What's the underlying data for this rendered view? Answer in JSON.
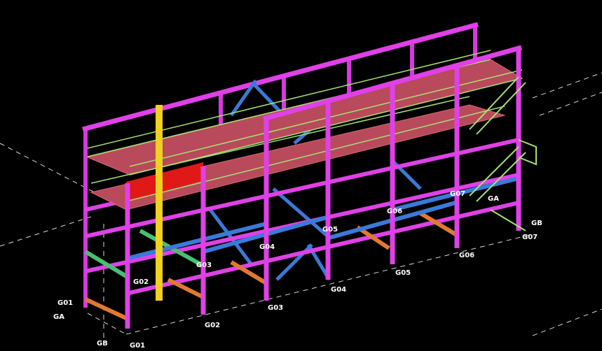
{
  "colors": {
    "background": "#000000",
    "column": "#e040e8",
    "deck": "#b84a5c",
    "deck_red": "#e01818",
    "railing": "#a8e070",
    "brace_blue": "#3a7ad8",
    "brace_orange": "#e07a30",
    "beam_green": "#48c070",
    "yellow": "#f0d020",
    "label": "#ffffff",
    "gridline": "#ffffff"
  },
  "grid_labels": {
    "g01_left": "G01",
    "ga_left": "GA",
    "gb_bottom": "GB",
    "g01_bottom": "G01",
    "g02_bottom": "G02",
    "g03_bottom": "G03",
    "g04_bottom": "G04",
    "g05_bottom": "G05",
    "g06_bottom": "G06",
    "g02_mid": "G02",
    "g03_mid": "G03",
    "g04_mid": "G04",
    "g05_mid": "G05",
    "g06_mid": "G06",
    "g07_mid": "G07",
    "ga_right": "GA",
    "gb_right": "GB",
    "g07_right": "G07"
  }
}
